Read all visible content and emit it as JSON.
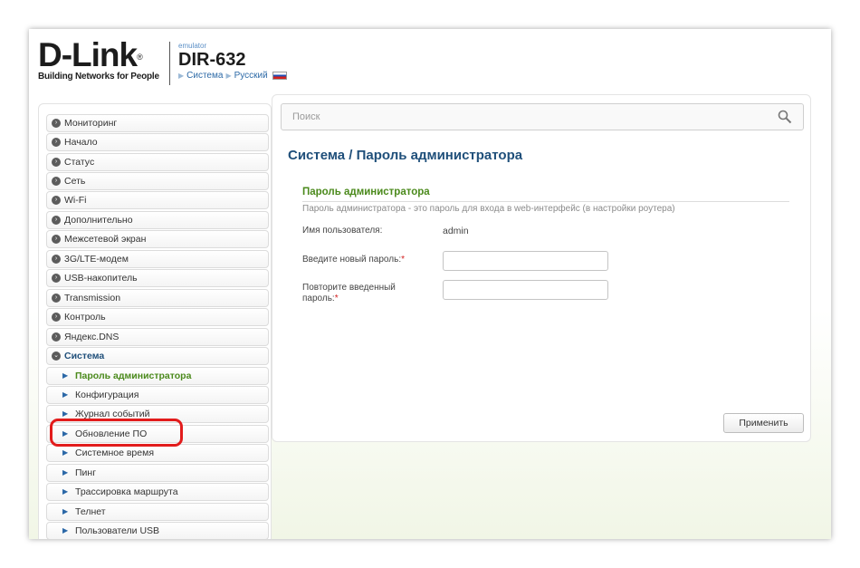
{
  "header": {
    "logo_text": "D-Link",
    "logo_reg": "®",
    "logo_tagline": "Building Networks for People",
    "emulator_label": "emulator",
    "model": "DIR-632",
    "crumb_system": "Система",
    "crumb_language": "Русский"
  },
  "sidebar": {
    "items": [
      {
        "label": "Мониторинг"
      },
      {
        "label": "Начало"
      },
      {
        "label": "Статус"
      },
      {
        "label": "Сеть"
      },
      {
        "label": "Wi-Fi"
      },
      {
        "label": "Дополнительно"
      },
      {
        "label": "Межсетевой экран"
      },
      {
        "label": "3G/LTE-модем"
      },
      {
        "label": "USB-накопитель"
      },
      {
        "label": "Transmission"
      },
      {
        "label": "Контроль"
      },
      {
        "label": "Яндекс.DNS"
      },
      {
        "label": "Система"
      },
      {
        "label": "Пароль администратора"
      },
      {
        "label": "Конфигурация"
      },
      {
        "label": "Журнал событий"
      },
      {
        "label": "Обновление ПО"
      },
      {
        "label": "Системное время"
      },
      {
        "label": "Пинг"
      },
      {
        "label": "Трассировка маршрута"
      },
      {
        "label": "Телнет"
      },
      {
        "label": "Пользователи USB"
      }
    ]
  },
  "search": {
    "placeholder": "Поиск"
  },
  "main": {
    "title": "Система /  Пароль администратора",
    "section_title": "Пароль администратора",
    "section_desc": "Пароль администратора - это пароль для входа в web-интерфейс (в настройки роутера)",
    "username_label": "Имя пользователя:",
    "username_value": "admin",
    "new_password_label": "Введите новый пароль:",
    "repeat_password_label_1": "Повторите введенный",
    "repeat_password_label_2": "пароль:",
    "required_mark": "*",
    "apply_label": "Применить"
  },
  "colors": {
    "accent_blue": "#1f4f7a",
    "accent_green": "#4b8a1c",
    "highlight_red": "#e21c1c"
  }
}
